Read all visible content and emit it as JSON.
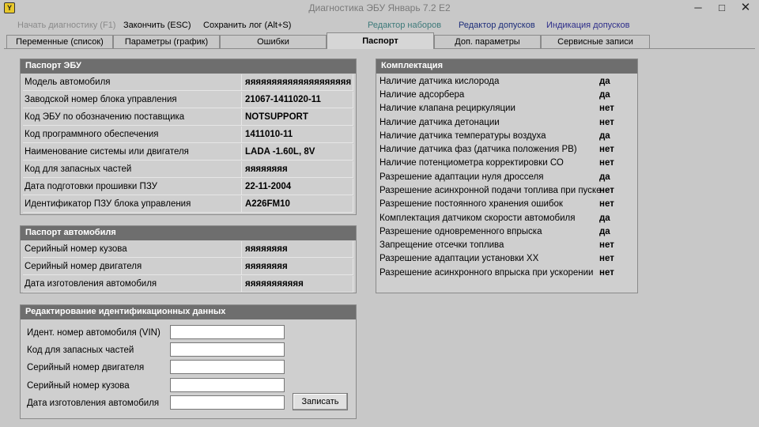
{
  "window": {
    "title": "Диагностика ЭБУ Январь 7.2 Е2",
    "logo_text": "Y",
    "minimize": "─",
    "maximize": "□",
    "close": "✕"
  },
  "menu": {
    "start": "Начать диагностику (F1)",
    "stop": "Закончить (ESC)",
    "save_log": "Сохранить лог (Alt+S)",
    "set_editor": "Редактор наборов",
    "tolerance_editor": "Редактор допусков",
    "tolerance_display": "Индикация допусков",
    "colors": {
      "disabled": "#8a8a8a",
      "set_editor": "#3d7a7a",
      "tolerance_editor": "#1d2d7a",
      "tolerance_display": "#2d2d8a"
    }
  },
  "tabs": [
    "Переменные (список)",
    "Параметры (график)",
    "Ошибки",
    "Паспорт",
    "Доп. параметры",
    "Сервисные записи"
  ],
  "active_tab": "Паспорт",
  "ecu_passport": {
    "header": "Паспорт ЭБУ",
    "rows": [
      {
        "label": "Модель автомобиля",
        "value": "яяяяяяяяяяяяяяяяяяяя"
      },
      {
        "label": "Заводской номер блока управления",
        "value": "21067-1411020-11"
      },
      {
        "label": "Код ЭБУ по обозначению поставщика",
        "value": "NOTSUPPORT"
      },
      {
        "label": "Код программного обеспечения",
        "value": "1411010-11"
      },
      {
        "label": "Наименование системы или двигателя",
        "value": "LADA -1.60L, 8V"
      },
      {
        "label": "Код для запасных частей",
        "value": "яяяяяяяя"
      },
      {
        "label": "Дата подготовки прошивки ПЗУ",
        "value": "22-11-2004"
      },
      {
        "label": "Идентификатор ПЗУ блока управления",
        "value": "A226FM10"
      }
    ]
  },
  "vehicle_passport": {
    "header": "Паспорт автомобиля",
    "rows": [
      {
        "label": "Серийный номер кузова",
        "value": "яяяяяяяя"
      },
      {
        "label": "Серийный номер двигателя",
        "value": "яяяяяяяя"
      },
      {
        "label": "Дата изготовления автомобиля",
        "value": "яяяяяяяяяяя"
      }
    ]
  },
  "edit_ids": {
    "header": "Редактирование идентификационных данных",
    "fields": [
      {
        "label": "Идент. номер автомобиля (VIN)",
        "value": ""
      },
      {
        "label": "Код для запасных частей",
        "value": ""
      },
      {
        "label": "Серийный номер двигателя",
        "value": ""
      },
      {
        "label": "Серийный номер кузова",
        "value": ""
      },
      {
        "label": "Дата изготовления автомобиля",
        "value": ""
      }
    ],
    "save_label": "Записать"
  },
  "configuration": {
    "header": "Комплектация",
    "rows": [
      {
        "label": "Наличие датчика кислорода",
        "value": "да"
      },
      {
        "label": "Наличие адсорбера",
        "value": "да"
      },
      {
        "label": "Наличие клапана рециркуляции",
        "value": "нет"
      },
      {
        "label": "Наличие датчика детонации",
        "value": "нет"
      },
      {
        "label": "Наличие датчика температуры воздуха",
        "value": "да"
      },
      {
        "label": "Наличие датчика фаз (датчика положения РВ)",
        "value": "нет"
      },
      {
        "label": "Наличие потенциометра корректировки СО",
        "value": "нет"
      },
      {
        "label": "Разрешение адаптации нуля дросселя",
        "value": "да"
      },
      {
        "label": "Разрешение асинхронной подачи топлива при пуске",
        "value": "нет"
      },
      {
        "label": "Разрешение постоянного хранения ошибок",
        "value": "нет"
      },
      {
        "label": "Комплектация датчиком скорости автомобиля",
        "value": "да"
      },
      {
        "label": "Разрешение одновременного впрыска",
        "value": "да"
      },
      {
        "label": "Запрещение отсечки топлива",
        "value": "нет"
      },
      {
        "label": "Разрешение адаптации установки XX",
        "value": "нет"
      },
      {
        "label": "Разрешение асинхронного впрыска при ускорении",
        "value": "нет"
      }
    ]
  }
}
